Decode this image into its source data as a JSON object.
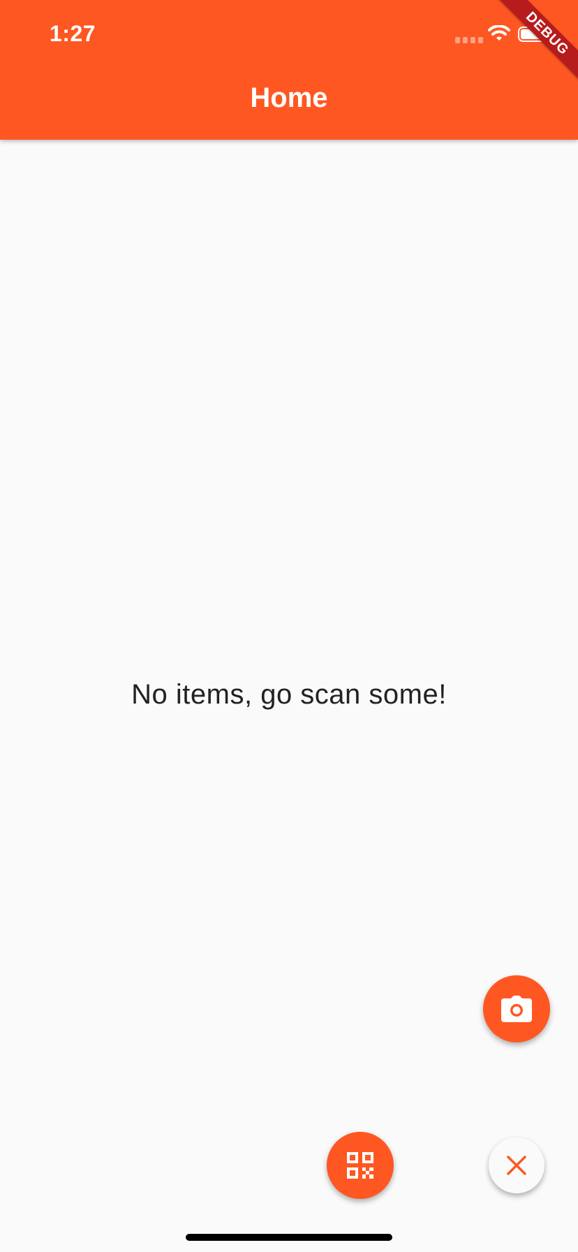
{
  "status_bar": {
    "time": "1:27"
  },
  "app_bar": {
    "title": "Home"
  },
  "debug_banner": {
    "label": "DEBUG"
  },
  "body": {
    "empty_message": "No items, go scan some!"
  },
  "fabs": {
    "camera": {
      "icon": "camera-icon"
    },
    "qr": {
      "icon": "qr-code-icon"
    },
    "close": {
      "icon": "close-icon"
    }
  },
  "colors": {
    "primary": "#FF5722",
    "background": "#FAFAFA",
    "text": "#222222",
    "debug_ribbon": "#B71C1C"
  }
}
